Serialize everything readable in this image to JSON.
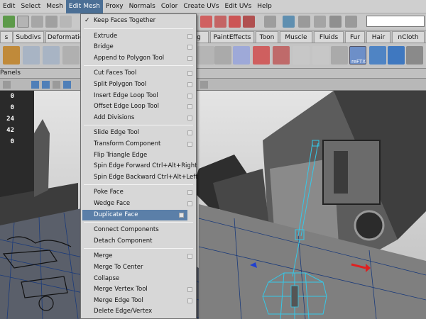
{
  "menubar": {
    "items": [
      "Edit",
      "Select",
      "Mesh",
      "Edit Mesh",
      "Proxy",
      "Normals",
      "Color",
      "Create UVs",
      "Edit UVs",
      "Help"
    ],
    "active": "Edit Mesh"
  },
  "shelf_tabs": [
    "s",
    "Subdivs",
    "Deformation",
    "g",
    "PaintEffects",
    "Toon",
    "Muscle",
    "Fluids",
    "Fur",
    "Hair",
    "nCloth"
  ],
  "panels_label": "Panels",
  "hud_values": [
    "0",
    "0",
    "24",
    "42",
    "0"
  ],
  "shelf_caption": "reFTX",
  "edit_mesh_menu": [
    {
      "label": "Keep Faces Together",
      "checked": true
    },
    {
      "separator": true
    },
    {
      "label": "Extrude",
      "option": true
    },
    {
      "label": "Bridge",
      "option": true
    },
    {
      "label": "Append to Polygon Tool",
      "option": true
    },
    {
      "separator": true
    },
    {
      "label": "Cut Faces Tool",
      "option": true
    },
    {
      "label": "Split Polygon Tool",
      "option": true
    },
    {
      "label": "Insert Edge Loop Tool",
      "option": true
    },
    {
      "label": "Offset Edge Loop Tool",
      "option": true
    },
    {
      "label": "Add Divisions",
      "option": true
    },
    {
      "separator": true
    },
    {
      "label": "Slide Edge Tool",
      "option": true
    },
    {
      "label": "Transform Component",
      "option": true
    },
    {
      "label": "Flip Triangle Edge"
    },
    {
      "label": "Spin Edge Forward  Ctrl+Alt+Right"
    },
    {
      "label": "Spin Edge Backward  Ctrl+Alt+Left"
    },
    {
      "separator": true
    },
    {
      "label": "Poke Face",
      "option": true
    },
    {
      "label": "Wedge Face",
      "option": true
    },
    {
      "label": "Duplicate Face",
      "option": true,
      "highlighted": true
    },
    {
      "separator": true
    },
    {
      "label": "Connect Components"
    },
    {
      "label": "Detach Component"
    },
    {
      "separator": true
    },
    {
      "label": "Merge",
      "option": true
    },
    {
      "label": "Merge To Center"
    },
    {
      "label": "Collapse"
    },
    {
      "label": "Merge Vertex Tool",
      "option": true
    },
    {
      "label": "Merge Edge Tool",
      "option": true
    },
    {
      "label": "Delete Edge/Vertex"
    }
  ],
  "colors": {
    "menu_highlight": "#5b7fa8",
    "menubar_active": "#4b6f95",
    "wireframe": "#35c8e8",
    "manipulator_red": "#e02020"
  }
}
